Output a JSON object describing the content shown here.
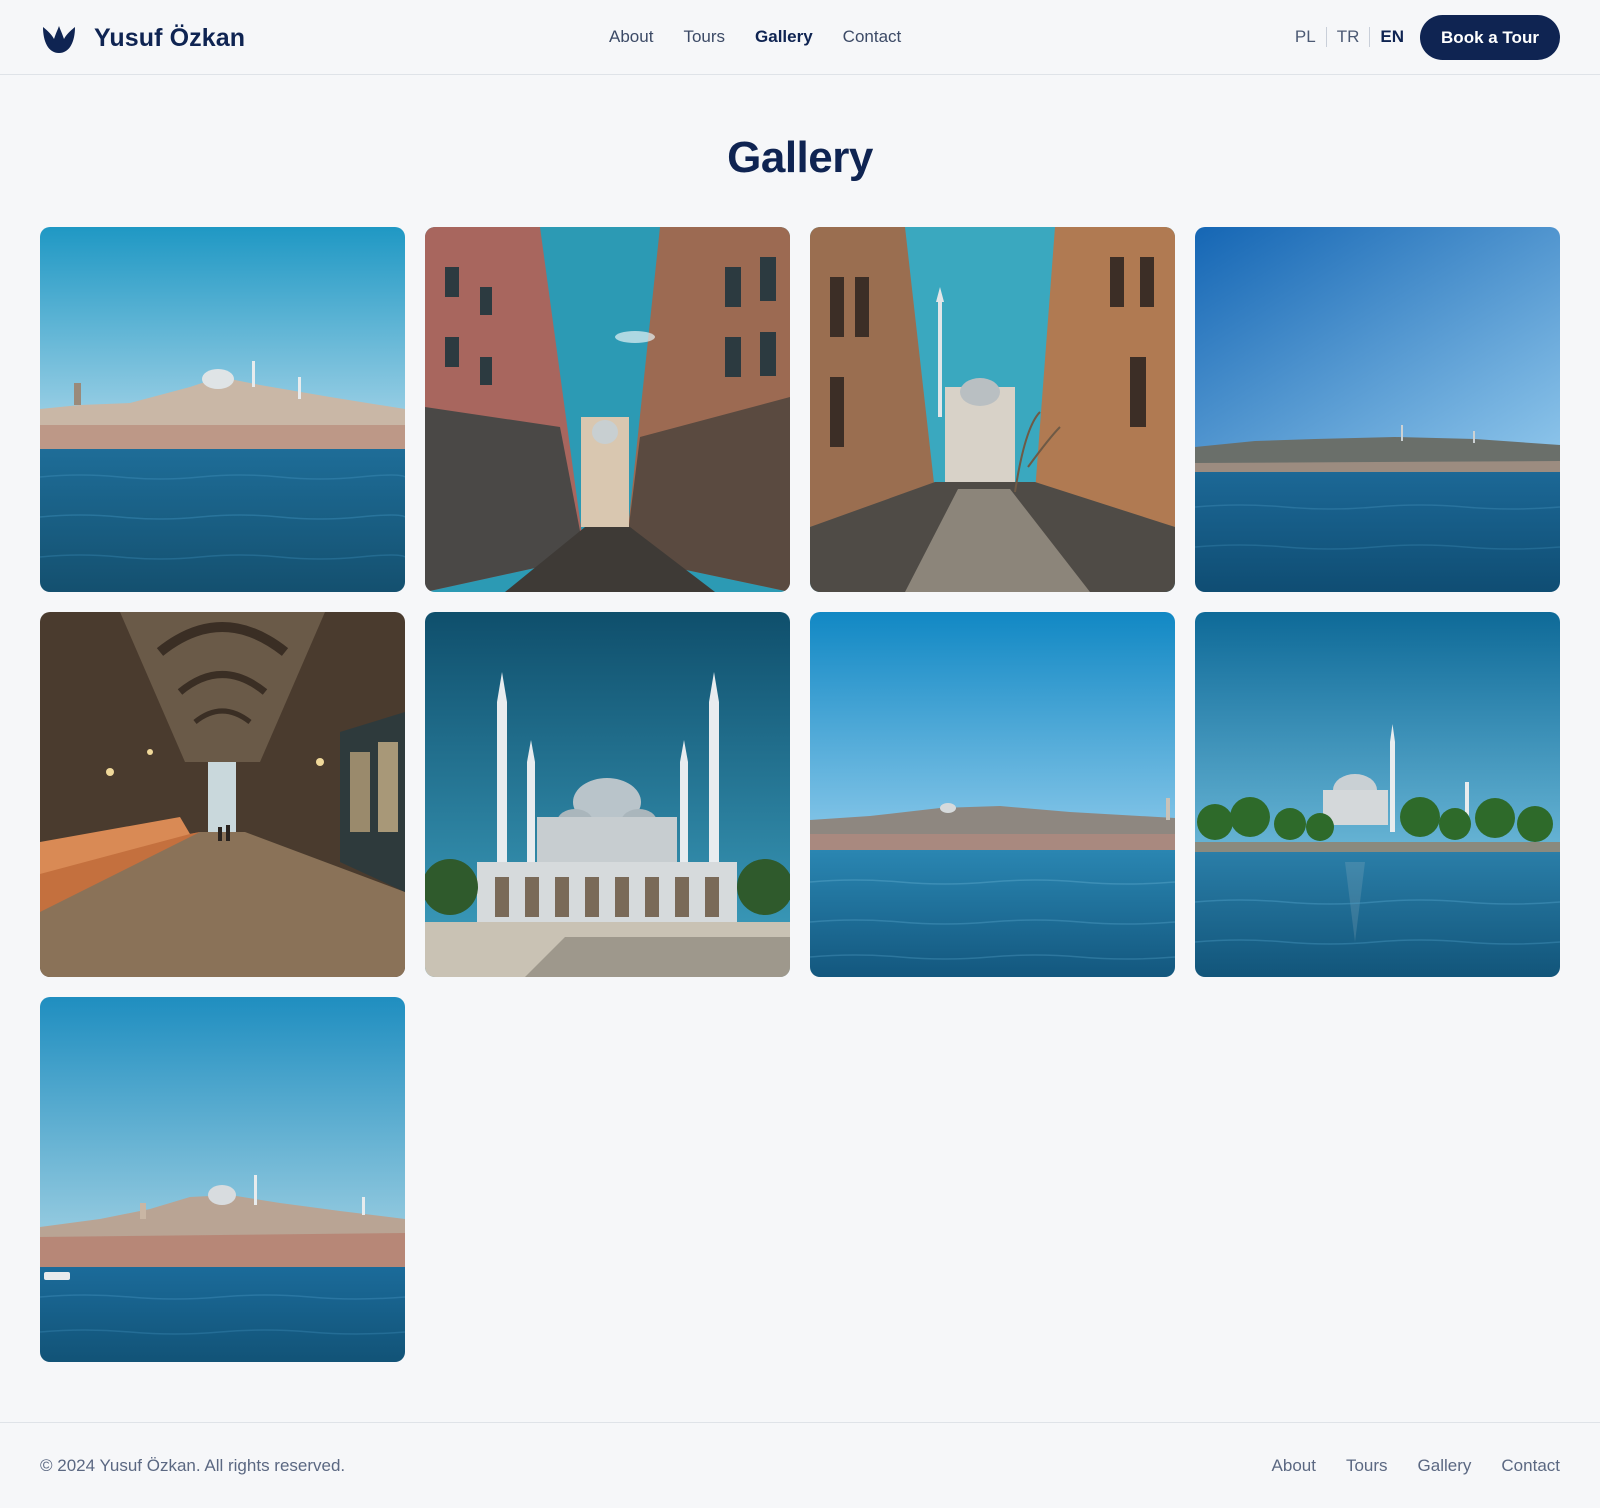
{
  "brand": {
    "name": "Yusuf Özkan",
    "logo_icon": "tulip-icon"
  },
  "nav": {
    "links": [
      "About",
      "Tours",
      "Gallery",
      "Contact"
    ],
    "active": "Gallery"
  },
  "languages": {
    "items": [
      "PL",
      "TR",
      "EN"
    ],
    "active": "EN"
  },
  "header": {
    "cta_label": "Book a Tour"
  },
  "page": {
    "title": "Gallery"
  },
  "gallery": {
    "photos": [
      {
        "subject": "istanbul-skyline-across-water-photo"
      },
      {
        "subject": "narrow-street-with-mosque-dome-photo"
      },
      {
        "subject": "cobbled-street-leading-to-mosque-photo"
      },
      {
        "subject": "bosphorus-distant-shoreline-photo"
      },
      {
        "subject": "grand-bazaar-arcade-photo"
      },
      {
        "subject": "mosque-with-four-minarets-photo"
      },
      {
        "subject": "bosphorus-low-skyline-photo"
      },
      {
        "subject": "mosque-by-the-shore-with-trees-photo"
      },
      {
        "subject": "istanbul-hillside-skyline-photo"
      }
    ]
  },
  "footer": {
    "copyright": "© 2024 Yusuf Özkan. All rights reserved.",
    "links": [
      "About",
      "Tours",
      "Gallery",
      "Contact"
    ]
  },
  "colors": {
    "primary": "#0f2452",
    "background": "#f6f7f9",
    "muted_text": "#5b6882",
    "sky": "#2a95c7",
    "sea": "#1d5f86"
  }
}
